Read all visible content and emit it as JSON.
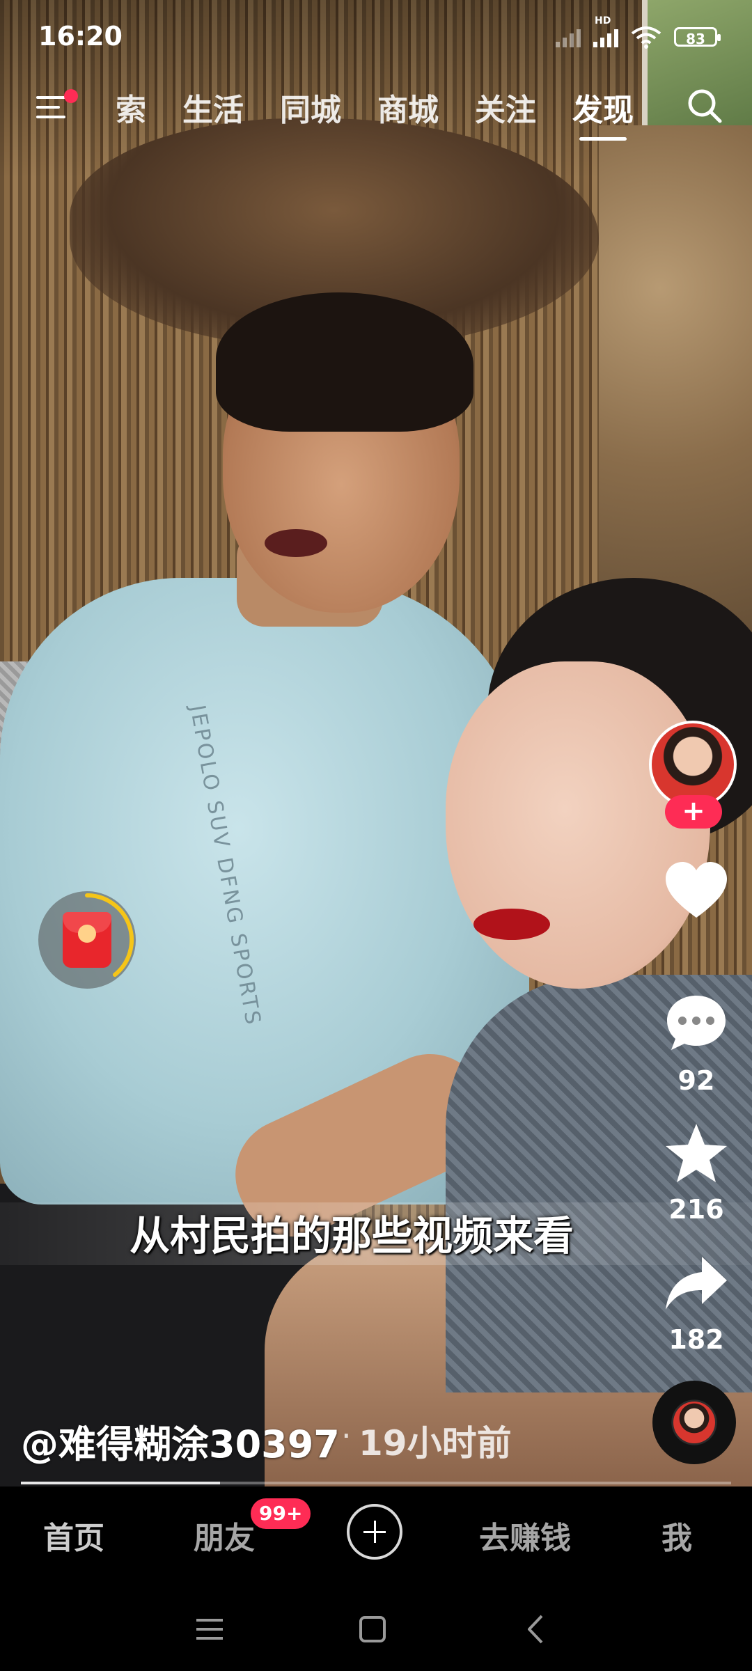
{
  "status_bar": {
    "time": "16:20",
    "network": "HD",
    "battery": "83"
  },
  "top_nav": {
    "tabs": [
      {
        "label": "探索",
        "visible": "索"
      },
      {
        "label": "生活"
      },
      {
        "label": "同城"
      },
      {
        "label": "商城"
      },
      {
        "label": "关注"
      },
      {
        "label": "发现",
        "active": true
      }
    ],
    "menu_icon": "menu-icon",
    "search_icon": "search-icon"
  },
  "actions": {
    "follow_label": "+",
    "like_icon": "heart-icon",
    "comment_icon": "comment-icon",
    "comment_count": "92",
    "favorite_icon": "star-icon",
    "favorite_count": "216",
    "share_icon": "share-icon",
    "share_count": "182"
  },
  "video": {
    "subtitle": "从村民拍的那些视频来看",
    "author": "@难得糊涂30397",
    "separator": "·",
    "posted": "19小时前",
    "progress": 0.28
  },
  "bottom_nav": {
    "home": "首页",
    "friends": "朋友",
    "friends_badge": "99+",
    "add_icon": "plus-icon",
    "earn": "去赚钱",
    "me": "我"
  },
  "system_nav": [
    "menu-icon",
    "home-square-icon",
    "back-icon"
  ],
  "colors": {
    "accent": "#fe2c55",
    "envelope": "#e8262c",
    "ring": "#f5c518"
  }
}
